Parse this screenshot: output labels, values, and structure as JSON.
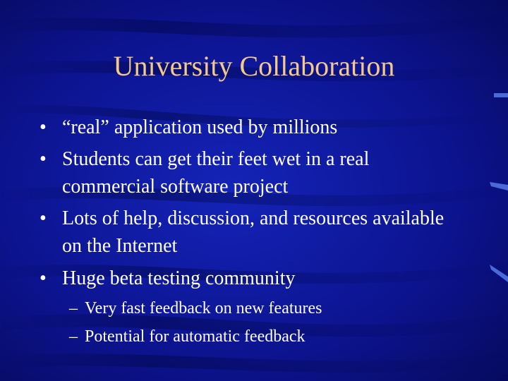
{
  "slide": {
    "title": "University Collaboration",
    "bullets": [
      {
        "marker": "•",
        "text": "“real” application used by millions"
      },
      {
        "marker": "•",
        "text": "Students can get their feet wet in a real commercial software project"
      },
      {
        "marker": "•",
        "text": "Lots of help, discussion, and resources available on the Internet"
      },
      {
        "marker": "•",
        "text": "Huge beta testing community"
      }
    ],
    "subbullets": [
      {
        "marker": "–",
        "text": "Very fast feedback on new features"
      },
      {
        "marker": "–",
        "text": "Potential for automatic feedback"
      }
    ]
  },
  "colors": {
    "background": "#0a0f7a",
    "title": "#f5c98a",
    "body_text": "#ffffff"
  }
}
